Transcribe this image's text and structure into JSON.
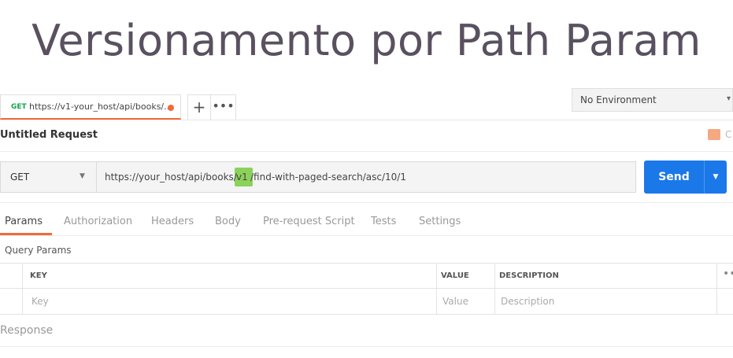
{
  "slide": {
    "title": "Versionamento por Path Param"
  },
  "tab": {
    "method": "GET",
    "url": "https://v1-your_host/api/books/...",
    "plus": "+",
    "more": "•••"
  },
  "environment": {
    "label": "No Environment",
    "caret": "▾"
  },
  "request": {
    "name": "Untitled Request",
    "comment_label": "C"
  },
  "urlbar": {
    "method": "GET",
    "method_caret": "▼",
    "url_prefix": "https://your_host/api/books/",
    "url_version": "v1",
    "url_suffix": "/find-with-paged-search/asc/10/1",
    "send_label": "Send",
    "send_caret": "▼"
  },
  "subtabs": [
    "Params",
    "Authorization",
    "Headers",
    "Body",
    "Pre-request Script",
    "Tests",
    "Settings"
  ],
  "params": {
    "section_label": "Query Params",
    "headers": {
      "key": "KEY",
      "value": "VALUE",
      "description": "DESCRIPTION",
      "more": "••"
    },
    "placeholders": {
      "key": "Key",
      "value": "Value",
      "description": "Description"
    }
  },
  "response": {
    "label": "Response"
  },
  "colors": {
    "accent": "#f26b3a",
    "send": "#1b78e8",
    "method_get": "#10a54a",
    "highlight": "#8cd25a"
  }
}
